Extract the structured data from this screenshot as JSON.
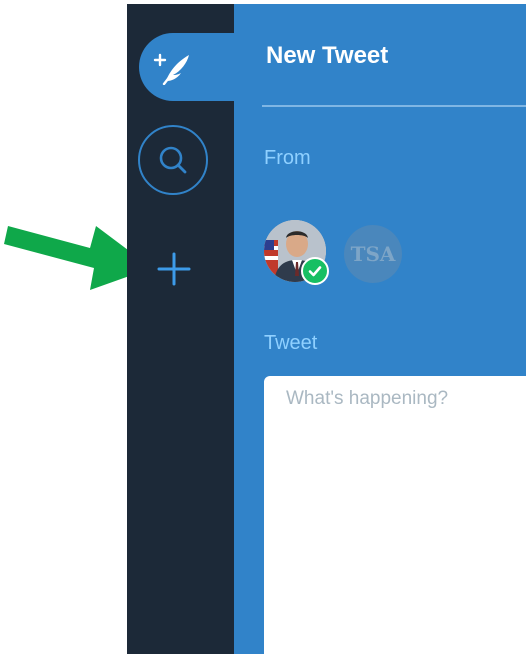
{
  "sidebar": {
    "compose_icon": "feather-plus-icon",
    "search_icon": "search-icon",
    "add_icon": "plus-icon"
  },
  "panel": {
    "title": "New Tweet",
    "from_label": "From",
    "accounts": [
      {
        "icon": "user-avatar-icon",
        "selected": true,
        "badge_icon": "checkmark-icon"
      },
      {
        "initials": "TSA",
        "selected": false
      }
    ],
    "tweet_label": "Tweet",
    "tweet": {
      "value": "",
      "placeholder": "What's happening?"
    }
  },
  "annotation": {
    "icon": "arrow-right-icon",
    "color": "#0fa84a"
  },
  "colors": {
    "sidebar_bg": "#1c2938",
    "panel_bg": "#3183c9",
    "label_color": "#8fd0ff",
    "verified_green": "#17bf63"
  }
}
